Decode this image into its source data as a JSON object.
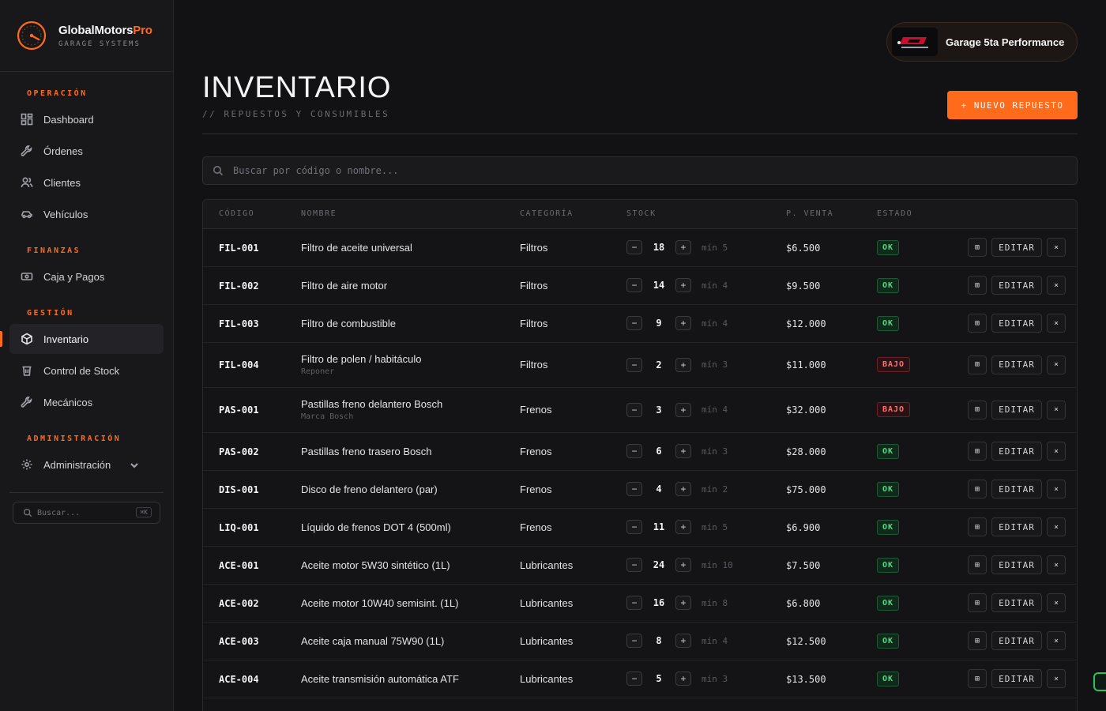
{
  "brand": {
    "name": "GlobalMotors",
    "name_accent": "Pro",
    "subtitle": "GARAGE SYSTEMS"
  },
  "sidebar": {
    "sections": [
      {
        "heading": "OPERACIÓN",
        "items": [
          {
            "label": "Dashboard",
            "icon": "dashboard-icon"
          },
          {
            "label": "Órdenes",
            "icon": "wrench-icon"
          },
          {
            "label": "Clientes",
            "icon": "users-icon"
          },
          {
            "label": "Vehículos",
            "icon": "car-icon"
          }
        ]
      },
      {
        "heading": "FINANZAS",
        "items": [
          {
            "label": "Caja y Pagos",
            "icon": "cash-icon"
          }
        ]
      },
      {
        "heading": "GESTIÓN",
        "items": [
          {
            "label": "Inventario",
            "icon": "box-icon",
            "active": true
          },
          {
            "label": "Control de Stock",
            "icon": "trash-bin-icon"
          },
          {
            "label": "Mecánicos",
            "icon": "wrench-icon"
          }
        ]
      },
      {
        "heading": "ADMINISTRACIÓN",
        "items": [
          {
            "label": "Administración",
            "icon": "gear-icon",
            "has_chevron": true
          }
        ]
      }
    ],
    "search_placeholder": "Buscar...",
    "search_shortcut": "⌘K"
  },
  "garage": {
    "name": "Garage 5ta Performance"
  },
  "page": {
    "title": "INVENTARIO",
    "subtitle": "// REPUESTOS Y CONSUMIBLES",
    "new_button": "+ NUEVO REPUESTO",
    "search_placeholder": "Buscar por código o nombre..."
  },
  "table": {
    "columns": [
      "CÓDIGO",
      "NOMBRE",
      "CATEGORÍA",
      "STOCK",
      "P. VENTA",
      "ESTADO"
    ],
    "edit_label": "EDITAR",
    "rows": [
      {
        "code": "FIL-001",
        "name": "Filtro de aceite universal",
        "note": "",
        "category": "Filtros",
        "stock": "18",
        "min": "mín 5",
        "price": "$6.500",
        "status": "OK"
      },
      {
        "code": "FIL-002",
        "name": "Filtro de aire motor",
        "note": "",
        "category": "Filtros",
        "stock": "14",
        "min": "mín 4",
        "price": "$9.500",
        "status": "OK"
      },
      {
        "code": "FIL-003",
        "name": "Filtro de combustible",
        "note": "",
        "category": "Filtros",
        "stock": "9",
        "min": "mín 4",
        "price": "$12.000",
        "status": "OK"
      },
      {
        "code": "FIL-004",
        "name": "Filtro de polen / habitáculo",
        "note": "Reponer",
        "category": "Filtros",
        "stock": "2",
        "min": "mín 3",
        "price": "$11.000",
        "status": "BAJO"
      },
      {
        "code": "PAS-001",
        "name": "Pastillas freno delantero Bosch",
        "note": "Marca Bosch",
        "category": "Frenos",
        "stock": "3",
        "min": "mín 4",
        "price": "$32.000",
        "status": "BAJO"
      },
      {
        "code": "PAS-002",
        "name": "Pastillas freno trasero Bosch",
        "note": "",
        "category": "Frenos",
        "stock": "6",
        "min": "mín 3",
        "price": "$28.000",
        "status": "OK"
      },
      {
        "code": "DIS-001",
        "name": "Disco de freno delantero (par)",
        "note": "",
        "category": "Frenos",
        "stock": "4",
        "min": "mín 2",
        "price": "$75.000",
        "status": "OK"
      },
      {
        "code": "LIQ-001",
        "name": "Líquido de frenos DOT 4 (500ml)",
        "note": "",
        "category": "Frenos",
        "stock": "11",
        "min": "mín 5",
        "price": "$6.900",
        "status": "OK"
      },
      {
        "code": "ACE-001",
        "name": "Aceite motor 5W30 sintético (1L)",
        "note": "",
        "category": "Lubricantes",
        "stock": "24",
        "min": "mín 10",
        "price": "$7.500",
        "status": "OK"
      },
      {
        "code": "ACE-002",
        "name": "Aceite motor 10W40 semisint. (1L)",
        "note": "",
        "category": "Lubricantes",
        "stock": "16",
        "min": "mín 8",
        "price": "$6.800",
        "status": "OK"
      },
      {
        "code": "ACE-003",
        "name": "Aceite caja manual 75W90 (1L)",
        "note": "",
        "category": "Lubricantes",
        "stock": "8",
        "min": "mín 4",
        "price": "$12.500",
        "status": "OK"
      },
      {
        "code": "ACE-004",
        "name": "Aceite transmisión automática ATF",
        "note": "",
        "category": "Lubricantes",
        "stock": "5",
        "min": "mín 3",
        "price": "$13.500",
        "status": "OK"
      }
    ]
  },
  "colors": {
    "accent": "#ff6b1a",
    "ok": "#4ade80",
    "low": "#f87171",
    "background": "#121214"
  }
}
